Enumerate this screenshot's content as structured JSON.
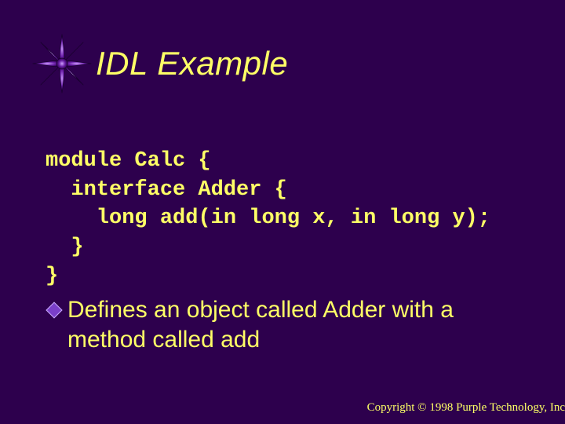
{
  "title": "IDL Example",
  "code": {
    "lines": [
      "module Calc {",
      "  interface Adder {",
      "    long add(in long x, in long y);",
      "  }",
      "}"
    ]
  },
  "bullet": {
    "text": "Defines an object called Adder with a method called add"
  },
  "footer": "Copyright © 1998 Purple Technology, Inc"
}
